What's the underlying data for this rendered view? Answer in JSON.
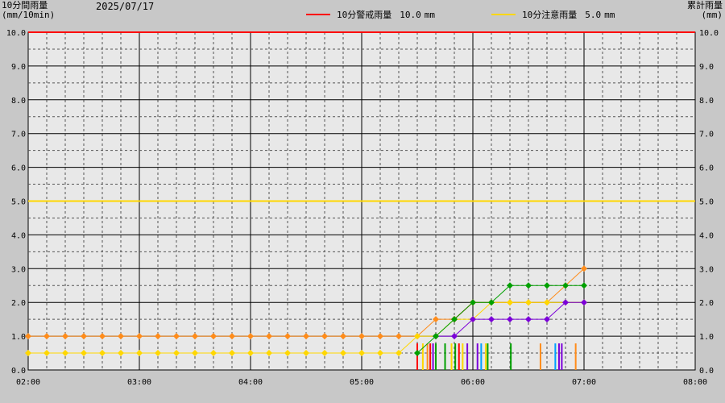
{
  "header": {
    "date": "2025/07/17",
    "left_axis_title": [
      "10分間雨量",
      "(mm/10min)"
    ],
    "right_axis_title": [
      "累計雨量",
      "(mm)"
    ]
  },
  "legend": [
    {
      "label": "10分警戒雨量",
      "value": "10.0",
      "unit": "mm",
      "color": "#ff0000"
    },
    {
      "label": "10分注意雨量",
      "value": "5.0",
      "unit": "mm",
      "color": "#ffd700"
    }
  ],
  "chart_data": {
    "type": "line",
    "x_tick_labels": [
      "02:00",
      "03:00",
      "04:00",
      "05:00",
      "06:00",
      "07:00",
      "08:00"
    ],
    "xlim_minutes": [
      120,
      480
    ],
    "y_tick_labels": [
      "0.0",
      "1.0",
      "2.0",
      "3.0",
      "4.0",
      "5.0",
      "6.0",
      "7.0",
      "8.0",
      "9.0",
      "10.0"
    ],
    "ylim": [
      0,
      10
    ],
    "grid": true,
    "thresholds": [
      {
        "value": 10.0,
        "color": "#ff0000"
      },
      {
        "value": 5.0,
        "color": "#ffd700"
      }
    ],
    "cumulative_series": [
      {
        "color": "#ff8c1a",
        "points": [
          [
            120,
            1.0
          ],
          [
            130,
            1.0
          ],
          [
            140,
            1.0
          ],
          [
            150,
            1.0
          ],
          [
            160,
            1.0
          ],
          [
            170,
            1.0
          ],
          [
            180,
            1.0
          ],
          [
            190,
            1.0
          ],
          [
            200,
            1.0
          ],
          [
            210,
            1.0
          ],
          [
            220,
            1.0
          ],
          [
            230,
            1.0
          ],
          [
            240,
            1.0
          ],
          [
            250,
            1.0
          ],
          [
            260,
            1.0
          ],
          [
            270,
            1.0
          ],
          [
            280,
            1.0
          ],
          [
            290,
            1.0
          ],
          [
            300,
            1.0
          ],
          [
            310,
            1.0
          ],
          [
            320,
            1.0
          ],
          [
            330,
            1.0
          ],
          [
            340,
            1.5
          ],
          [
            350,
            1.5
          ],
          [
            360,
            2.0
          ],
          [
            370,
            2.0
          ],
          [
            380,
            2.0
          ],
          [
            390,
            2.0
          ],
          [
            400,
            2.0
          ],
          [
            410,
            2.5
          ],
          [
            420,
            3.0
          ]
        ]
      },
      {
        "color": "#ffd700",
        "points": [
          [
            120,
            0.5
          ],
          [
            130,
            0.5
          ],
          [
            140,
            0.5
          ],
          [
            150,
            0.5
          ],
          [
            160,
            0.5
          ],
          [
            170,
            0.5
          ],
          [
            180,
            0.5
          ],
          [
            190,
            0.5
          ],
          [
            200,
            0.5
          ],
          [
            210,
            0.5
          ],
          [
            220,
            0.5
          ],
          [
            230,
            0.5
          ],
          [
            240,
            0.5
          ],
          [
            250,
            0.5
          ],
          [
            260,
            0.5
          ],
          [
            270,
            0.5
          ],
          [
            280,
            0.5
          ],
          [
            290,
            0.5
          ],
          [
            300,
            0.5
          ],
          [
            310,
            0.5
          ],
          [
            320,
            0.5
          ],
          [
            330,
            1.0
          ],
          [
            340,
            1.0
          ],
          [
            350,
            1.5
          ],
          [
            360,
            1.5
          ],
          [
            370,
            2.0
          ],
          [
            380,
            2.0
          ],
          [
            390,
            2.0
          ],
          [
            400,
            2.0
          ],
          [
            410,
            2.0
          ],
          [
            420,
            2.0
          ]
        ]
      },
      {
        "color": "#ff0000",
        "points": [
          [
            350,
            1.5
          ],
          [
            360,
            2.0
          ]
        ]
      },
      {
        "color": "#7b00d9",
        "points": [
          [
            340,
            1.0
          ],
          [
            350,
            1.0
          ],
          [
            360,
            1.5
          ],
          [
            370,
            1.5
          ],
          [
            380,
            1.5
          ],
          [
            390,
            1.5
          ],
          [
            400,
            1.5
          ],
          [
            410,
            2.0
          ],
          [
            420,
            2.0
          ]
        ]
      },
      {
        "color": "#00a000",
        "points": [
          [
            330,
            0.5
          ],
          [
            340,
            1.0
          ],
          [
            350,
            1.5
          ],
          [
            360,
            2.0
          ],
          [
            370,
            2.0
          ],
          [
            380,
            2.5
          ],
          [
            390,
            2.5
          ],
          [
            400,
            2.5
          ],
          [
            410,
            2.5
          ],
          [
            420,
            2.5
          ]
        ]
      }
    ],
    "interval_bars": [
      {
        "minute": 330.0,
        "value": 0.5,
        "color": "#ff0000"
      },
      {
        "minute": 333.0,
        "value": 0.5,
        "color": "#ffd700"
      },
      {
        "minute": 335.5,
        "value": 0.5,
        "color": "#ff8c1a"
      },
      {
        "minute": 337.0,
        "value": 0.5,
        "color": "#ff0000"
      },
      {
        "minute": 338.5,
        "value": 0.5,
        "color": "#7b00d9"
      },
      {
        "minute": 340.0,
        "value": 0.5,
        "color": "#00a000"
      },
      {
        "minute": 345.0,
        "value": 0.5,
        "color": "#00a000"
      },
      {
        "minute": 348.5,
        "value": 0.5,
        "color": "#ffd700"
      },
      {
        "minute": 350.5,
        "value": 0.5,
        "color": "#00a000"
      },
      {
        "minute": 352.5,
        "value": 0.5,
        "color": "#ff0000"
      },
      {
        "minute": 354.5,
        "value": 0.5,
        "color": "#ffd700"
      },
      {
        "minute": 357.0,
        "value": 0.5,
        "color": "#7b00d9"
      },
      {
        "minute": 362.5,
        "value": 0.5,
        "color": "#7b00d9"
      },
      {
        "minute": 364.5,
        "value": 0.5,
        "color": "#00a0ff"
      },
      {
        "minute": 367.0,
        "value": 0.5,
        "color": "#ffd700"
      },
      {
        "minute": 368.0,
        "value": 0.5,
        "color": "#00a000"
      },
      {
        "minute": 380.5,
        "value": 0.5,
        "color": "#00a000"
      },
      {
        "minute": 396.5,
        "value": 0.5,
        "color": "#ff8c1a"
      },
      {
        "minute": 404.5,
        "value": 0.5,
        "color": "#00a0ff"
      },
      {
        "minute": 406.5,
        "value": 0.5,
        "color": "#7b00d9"
      },
      {
        "minute": 408.0,
        "value": 0.5,
        "color": "#7b00d9"
      },
      {
        "minute": 415.5,
        "value": 0.5,
        "color": "#ff8c1a"
      }
    ]
  }
}
